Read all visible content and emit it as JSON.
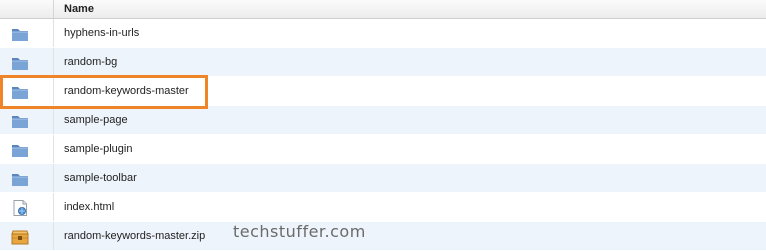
{
  "header": {
    "name_label": "Name"
  },
  "files": [
    {
      "name": "hyphens-in-urls",
      "type": "folder"
    },
    {
      "name": "random-bg",
      "type": "folder"
    },
    {
      "name": "random-keywords-master",
      "type": "folder",
      "highlighted": true
    },
    {
      "name": "sample-page",
      "type": "folder"
    },
    {
      "name": "sample-plugin",
      "type": "folder"
    },
    {
      "name": "sample-toolbar",
      "type": "folder"
    },
    {
      "name": "index.html",
      "type": "html-file"
    },
    {
      "name": "random-keywords-master.zip",
      "type": "zip-file"
    }
  ],
  "highlight_color": "#f08528",
  "watermark": "techstuffer.com"
}
